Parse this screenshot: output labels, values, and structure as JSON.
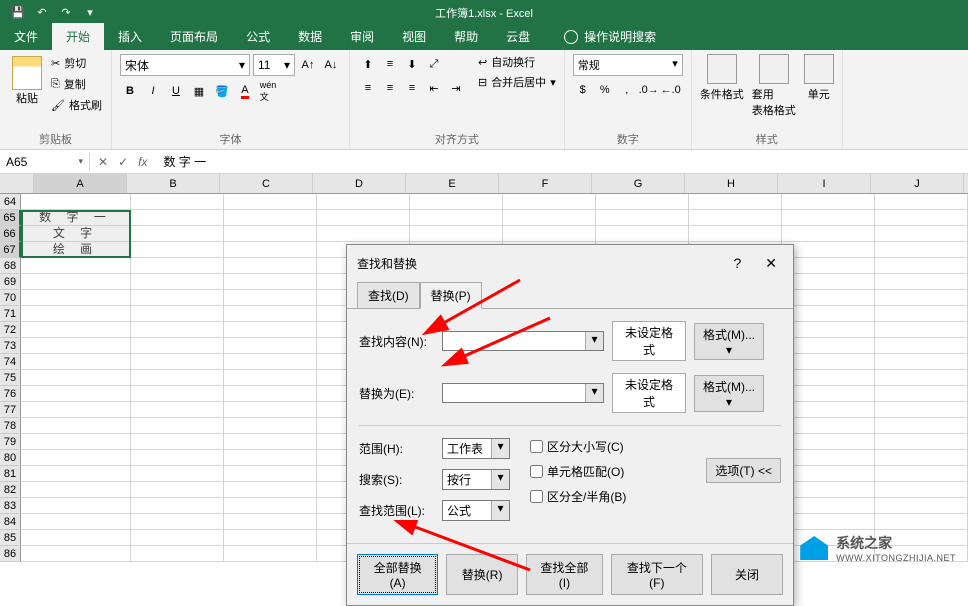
{
  "titlebar": {
    "title": "工作簿1.xlsx - Excel"
  },
  "tabs": {
    "file": "文件",
    "home": "开始",
    "insert": "插入",
    "pagelayout": "页面布局",
    "formulas": "公式",
    "data": "数据",
    "review": "审阅",
    "view": "视图",
    "help": "帮助",
    "cloud": "云盘",
    "tellme": "操作说明搜索"
  },
  "ribbon": {
    "clipboard": {
      "paste": "粘贴",
      "cut": "剪切",
      "copy": "复制",
      "formatpainter": "格式刷",
      "label": "剪贴板"
    },
    "font": {
      "name": "宋体",
      "size": "11",
      "label": "字体"
    },
    "alignment": {
      "wrap": "自动换行",
      "merge": "合并后居中",
      "label": "对齐方式"
    },
    "number": {
      "format": "常规",
      "label": "数字"
    },
    "styles": {
      "conditional": "条件格式",
      "formatastable": "套用\n表格格式",
      "cellstyles": "单元\n",
      "label": "样式"
    }
  },
  "namebox": {
    "ref": "A65"
  },
  "formula": {
    "value": "数 字 一"
  },
  "gridcells": {
    "a65": "数 字 一",
    "a66": "文 字",
    "a67": "绘 画"
  },
  "columns": [
    "A",
    "B",
    "C",
    "D",
    "E",
    "F",
    "G",
    "H",
    "I",
    "J"
  ],
  "rows": [
    "64",
    "65",
    "66",
    "67",
    "68",
    "69",
    "70",
    "71",
    "72",
    "73",
    "74",
    "75",
    "76",
    "77",
    "78",
    "79",
    "80",
    "81",
    "82",
    "83",
    "84",
    "85",
    "86"
  ],
  "dialog": {
    "title": "查找和替换",
    "tab_find": "查找(D)",
    "tab_replace": "替换(P)",
    "find_label": "查找内容(N):",
    "replace_label": "替换为(E):",
    "noformat": "未设定格式",
    "format_btn": "格式(M)...",
    "within_label": "范围(H):",
    "within_val": "工作表",
    "search_label": "搜索(S):",
    "search_val": "按行",
    "lookin_label": "查找范围(L):",
    "lookin_val": "公式",
    "matchcase": "区分大小写(C)",
    "matchcell": "单元格匹配(O)",
    "matchwidth": "区分全/半角(B)",
    "options": "选项(T) <<",
    "replace_all": "全部替换(A)",
    "replace_btn": "替换(R)",
    "find_all": "查找全部(I)",
    "find_next": "查找下一个(F)",
    "close": "关闭"
  },
  "watermark": {
    "cn": "系统之家",
    "url": "WWW.XITONGZHIJIA.NET"
  }
}
